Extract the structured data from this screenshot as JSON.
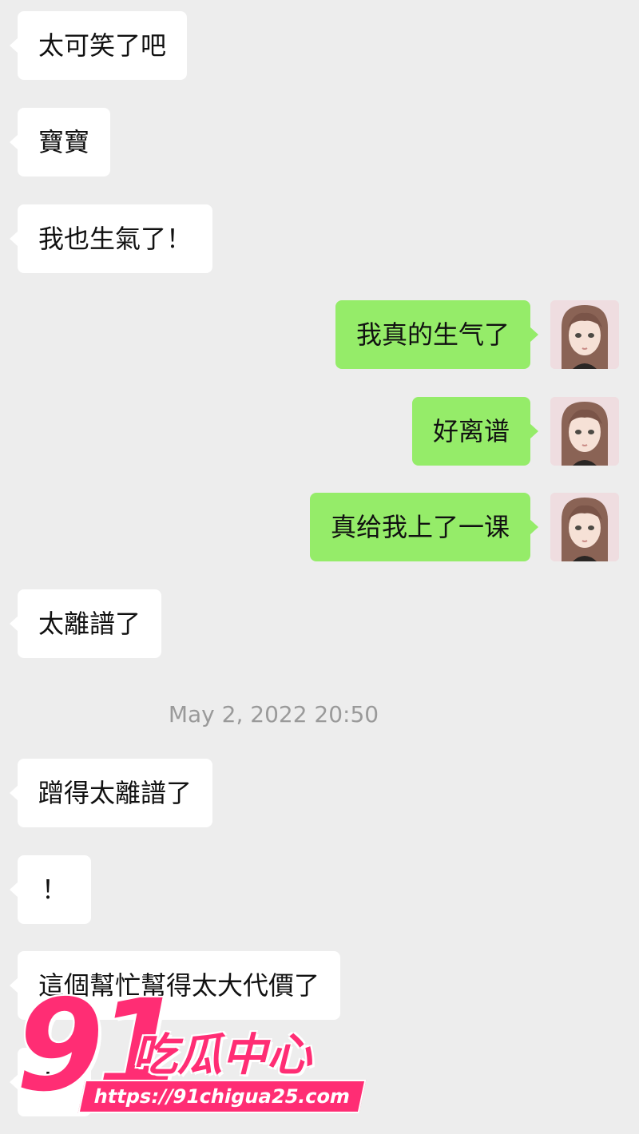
{
  "messages": [
    {
      "side": "in",
      "text": "太可笑了吧"
    },
    {
      "side": "in",
      "text": "寶寶"
    },
    {
      "side": "in",
      "text": "我也生氣了！"
    },
    {
      "side": "out",
      "text": "我真的生气了"
    },
    {
      "side": "out",
      "text": "好离谱"
    },
    {
      "side": "out",
      "text": "真给我上了一课"
    },
    {
      "side": "in",
      "text": "太離譜了"
    },
    {
      "side": "in",
      "text": "蹭得太離譜了"
    },
    {
      "side": "in",
      "text": "！"
    },
    {
      "side": "in",
      "text": "這個幫忙幫得太大代價了"
    },
    {
      "side": "in",
      "text": "！"
    }
  ],
  "timestamp": "May 2, 2022 20:50",
  "watermark": {
    "number": "91",
    "name": "吃瓜中心",
    "url": "https://91chigua25.com"
  },
  "colors": {
    "background": "#ededed",
    "incoming_bubble": "#ffffff",
    "outgoing_bubble": "#95ec69",
    "watermark": "#ff2d74"
  }
}
